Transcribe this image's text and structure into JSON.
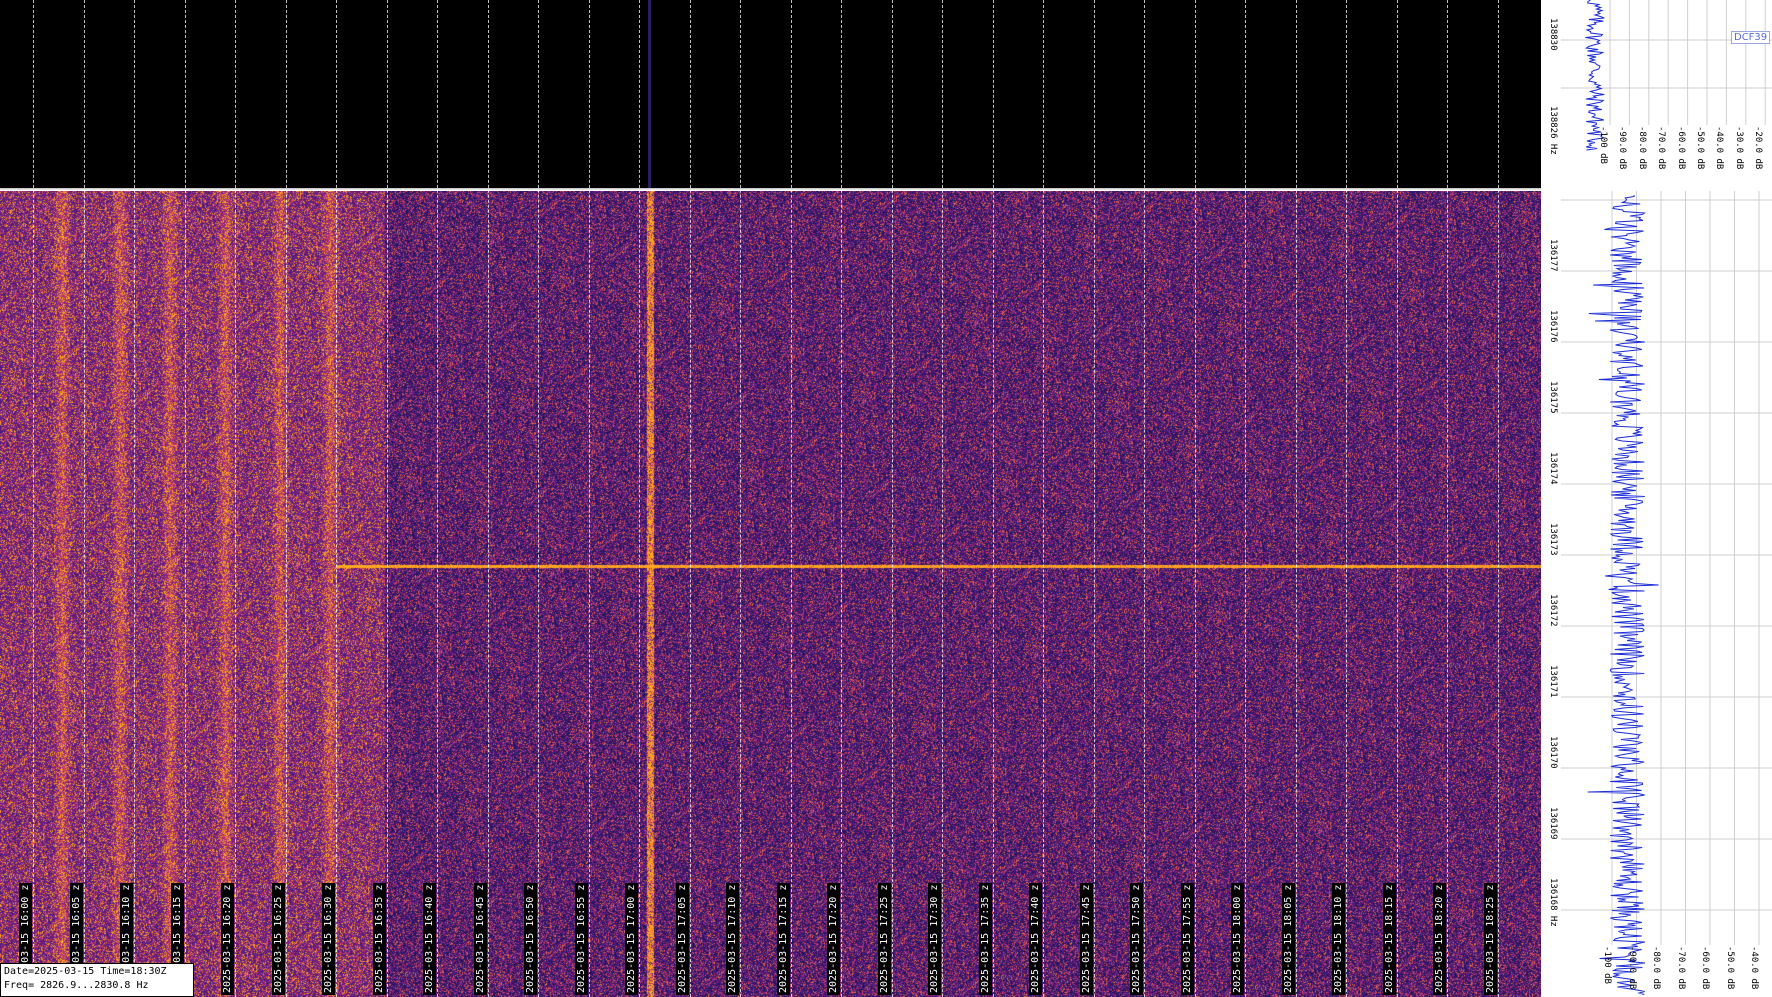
{
  "window": {
    "station_label": "DCF39"
  },
  "info": {
    "date_time": "Date=2025-03-15 Time=18:30Z",
    "freq_range": "Freq= 2826.9...2830.8 Hz"
  },
  "axes": {
    "top_freq_labels": [
      "138830",
      "138826 Hz"
    ],
    "main_freq_labels": [
      "136177",
      "136176",
      "136175",
      "136174",
      "136173",
      "136172",
      "136171",
      "136170",
      "136169",
      "136168 Hz"
    ],
    "top_db_labels": [
      "-100 dB",
      "-90.0 dB",
      "-80.0 dB",
      "-70.0 dB",
      "-60.0 dB",
      "-50.0 dB",
      "-40.0 dB",
      "-30.0 dB",
      "-20.0 dB"
    ],
    "bottom_db_labels": [
      "-100 dB",
      "-90.0 dB",
      "-80.0 dB",
      "-70.0 dB",
      "-60.0 dB",
      "-50.0 dB",
      "-40.0 dB"
    ]
  },
  "time_labels": [
    "2025-03-15 16:00 z",
    "2025-03-15 16:05 z",
    "2025-03-15 16:10 z",
    "2025-03-15 16:15 z",
    "2025-03-15 16:20 z",
    "2025-03-15 16:25 z",
    "2025-03-15 16:30 z",
    "2025-03-15 16:35 z",
    "2025-03-15 16:40 z",
    "2025-03-15 16:45 z",
    "2025-03-15 16:50 z",
    "2025-03-15 16:55 z",
    "2025-03-15 17:00 z",
    "2025-03-15 17:05 z",
    "2025-03-15 17:10 z",
    "2025-03-15 17:15 z",
    "2025-03-15 17:20 z",
    "2025-03-15 17:25 z",
    "2025-03-15 17:30 z",
    "2025-03-15 17:35 z",
    "2025-03-15 17:40 z",
    "2025-03-15 17:45 z",
    "2025-03-15 17:50 z",
    "2025-03-15 17:55 z",
    "2025-03-15 18:00 z",
    "2025-03-15 18:05 z",
    "2025-03-15 18:10 z",
    "2025-03-15 18:15 z",
    "2025-03-15 18:20 z",
    "2025-03-15 18:25 z"
  ],
  "colors": {
    "background_low": "#2a1d6a",
    "noise_mid": "#8a2a8e",
    "signal_high": "#f5a623",
    "grid": "#ffffff",
    "spectrum_trace": "#1a2bd6"
  }
}
